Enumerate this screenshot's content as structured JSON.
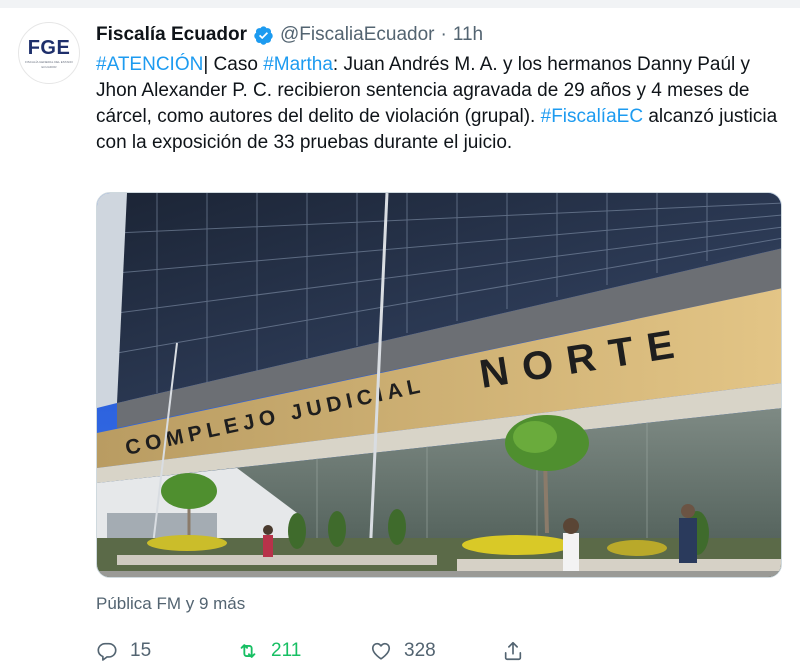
{
  "tweet": {
    "author": {
      "display_name": "Fiscalía Ecuador",
      "handle": "@FiscaliaEcuador",
      "avatar_text": "FGE",
      "avatar_subtext1": "FISCALÍA GENERAL DEL ESTADO",
      "avatar_subtext2": "ECUADOR",
      "verified_icon": "verified-badge-icon"
    },
    "separator": "·",
    "time": "11h",
    "text": {
      "hashtag_atencion": "#ATENCIÓN",
      "part1": "| Caso ",
      "hashtag_martha": "#Martha",
      "part2": ": Juan Andrés M. A. y los hermanos Danny Paúl y Jhon Alexander P. C. recibieron sentencia agravada de 29 años y 4 meses de cárcel, como autores del delito de violación (grupal). ",
      "hashtag_fiscalia": "#FiscalíaEC",
      "part3": " alcanzó justicia con la exposición de 33 pruebas durante el juicio."
    },
    "image": {
      "sign_text_1": "COMPLEJO JUDICIAL",
      "sign_text_2": "NORTE"
    },
    "liked_by": "Pública FM y 9 más",
    "actions": {
      "reply_count": "15",
      "retweet_count": "211",
      "like_count": "328",
      "reply_icon": "reply-icon",
      "retweet_icon": "retweet-icon",
      "like_icon": "heart-icon",
      "share_icon": "share-icon"
    },
    "colors": {
      "link": "#1d9bf0",
      "retweet_active": "#17bf63",
      "secondary_text": "#536471"
    }
  }
}
